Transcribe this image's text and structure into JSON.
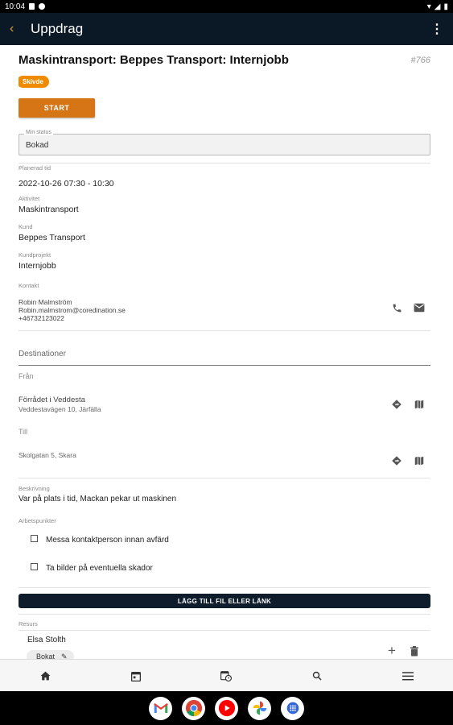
{
  "status_bar": {
    "time": "10:04"
  },
  "app_bar": {
    "title": "Uppdrag"
  },
  "job": {
    "title": "Maskintransport: Beppes Transport: Internjobb",
    "id": "#766",
    "badge": "Skivde",
    "start_label": "START",
    "my_status_label": "Min status",
    "my_status_value": "Bokad"
  },
  "details": {
    "planned_label": "Planerad tid",
    "planned_value": "2022-10-26 07:30 - 10:30",
    "activity_label": "Aktivitet",
    "activity_value": "Maskintransport",
    "customer_label": "Kund",
    "customer_value": "Beppes Transport",
    "project_label": "Kundprojekt",
    "project_value": "Internjobb",
    "contact_label": "Kontakt",
    "contact_name": "Robin Malmström",
    "contact_email": "Robin.malmstrom@coredination.se",
    "contact_phone": "+46732123022"
  },
  "destinations": {
    "heading": "Destinationer",
    "from_label": "Från",
    "from_name": "Förrådet i Veddesta",
    "from_address": "Veddestavägen 10, Järfälla",
    "to_label": "Till",
    "to_address": "Skolgatan 5, Skara"
  },
  "description": {
    "label": "Beskrivning",
    "value": "Var på plats i tid, Mackan pekar ut maskinen"
  },
  "work_points": {
    "label": "Arbetspunkter",
    "items": [
      "Messa kontaktperson innan avfärd",
      "Ta bilder på eventuella skador"
    ]
  },
  "add_link_label": "LÄGG TILL FIL ELLER LÄNK",
  "resources": {
    "label": "Resurs",
    "name": "Elsa Stolth",
    "chip": "Bokat"
  },
  "colors": {
    "app_bar": "#0b1826",
    "accent": "#d67515",
    "badge": "#f08a00"
  }
}
